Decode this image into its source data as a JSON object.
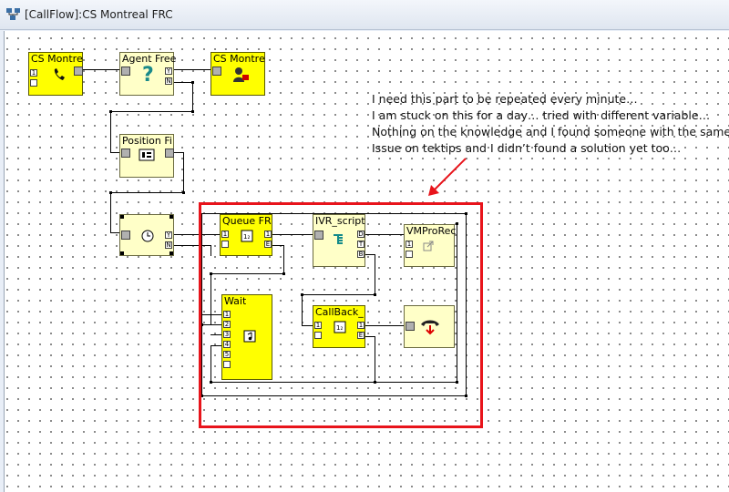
{
  "window": {
    "title": "[CallFlow]:CS Montreal FRC"
  },
  "nodes": {
    "cs_montreal_1": {
      "label": "CS Montre"
    },
    "agent_free": {
      "label": "Agent Free"
    },
    "cs_montreal_2": {
      "label": "CS Montre"
    },
    "position": {
      "label": "Position Fi"
    },
    "queue_fr": {
      "label": "Queue FR"
    },
    "ivr_script": {
      "label": "IVR_script"
    },
    "vmpro_rec": {
      "label": "VMProRec"
    },
    "wait": {
      "label": "Wait"
    },
    "callback": {
      "label": "CallBack_"
    }
  },
  "ports": {
    "y": "Y",
    "n": "N",
    "e": "E",
    "one": "1",
    "two": "2",
    "three": "3",
    "four": "4",
    "five": "5",
    "d": "D",
    "t": "T",
    "b": "B"
  },
  "annotation": {
    "lines": [
      "I need this part to be repeated every minute…",
      "I am stuck on this for a day… tried with different variable…",
      "Nothing on the knowledge and I found someone with the same",
      "Issue on tektips and I didn’t found a solution yet too…"
    ]
  },
  "icons": [
    "callflow-window-icon",
    "phone-icon",
    "question-icon",
    "agent-icon",
    "position-icon",
    "clock-icon",
    "queue-icon",
    "ivr-icon",
    "vmpro-icon",
    "music-note-icon",
    "callback-icon",
    "transfer-icon"
  ],
  "colors": {
    "node_yellow": "#ffff00",
    "node_cream": "#ffffc8",
    "highlight_red": "#e8141b"
  }
}
